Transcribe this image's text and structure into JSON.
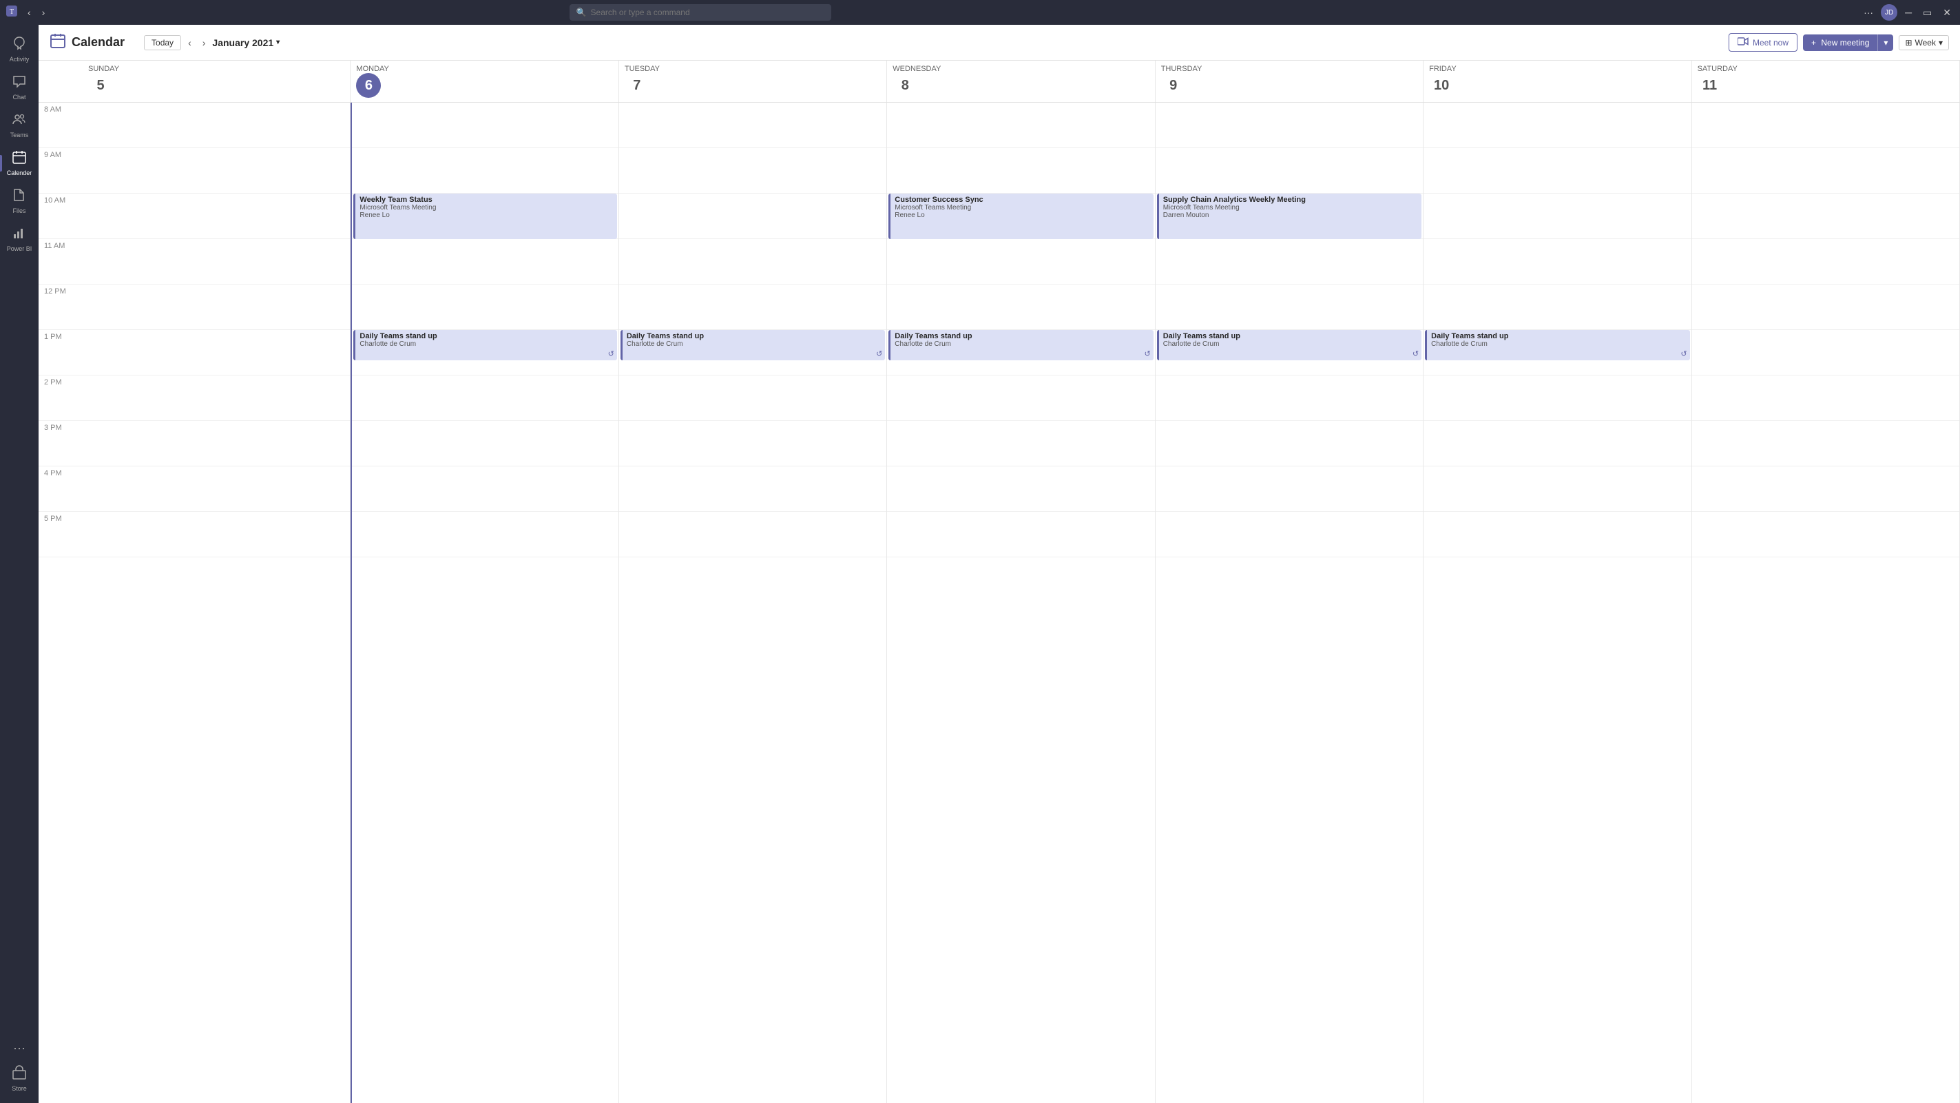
{
  "titlebar": {
    "logo": "⊞",
    "nav_back": "‹",
    "nav_forward": "›",
    "search_placeholder": "Search or type a command",
    "more": "···",
    "avatar_initials": "JD",
    "minimize": "─",
    "restore": "▭",
    "close": "✕"
  },
  "sidebar": {
    "items": [
      {
        "id": "activity",
        "label": "Activity",
        "icon": "🔔"
      },
      {
        "id": "chat",
        "label": "Chat",
        "icon": "💬"
      },
      {
        "id": "teams",
        "label": "Teams",
        "icon": "👥"
      },
      {
        "id": "calendar",
        "label": "Calender",
        "icon": "📅",
        "active": true
      },
      {
        "id": "files",
        "label": "Files",
        "icon": "📁"
      },
      {
        "id": "powerbi",
        "label": "Power BI",
        "icon": "📊"
      }
    ],
    "bottom_items": [
      {
        "id": "more",
        "label": "···",
        "icon": "···"
      },
      {
        "id": "store",
        "label": "Store",
        "icon": "🏪"
      }
    ]
  },
  "calendar": {
    "title": "Calendar",
    "today_label": "Today",
    "month_label": "January 2021",
    "meet_now_label": "Meet now",
    "new_meeting_label": "New meeting",
    "view_label": "Week",
    "days": [
      {
        "num": "5",
        "name": "Sunday",
        "today": false
      },
      {
        "num": "6",
        "name": "Monday",
        "today": true
      },
      {
        "num": "7",
        "name": "Tuesday",
        "today": false
      },
      {
        "num": "8",
        "name": "Wednesday",
        "today": false
      },
      {
        "num": "9",
        "name": "Thursday",
        "today": false
      },
      {
        "num": "10",
        "name": "Friday",
        "today": false
      },
      {
        "num": "11",
        "name": "Saturday",
        "today": false
      }
    ],
    "time_slots": [
      "8 AM",
      "9 AM",
      "10 AM",
      "11 AM",
      "12 PM",
      "1 PM",
      "2 PM",
      "3 PM",
      "4 PM",
      "5 PM"
    ],
    "events": [
      {
        "id": "ev1",
        "title": "Weekly Team Status",
        "sub1": "Microsoft Teams Meeting",
        "sub2": "Renee Lo",
        "day": 1,
        "slot_start": 2,
        "slot_offset": 0,
        "height": 66,
        "recurring": false
      },
      {
        "id": "ev2",
        "title": "Customer Success Sync",
        "sub1": "Microsoft Teams Meeting",
        "sub2": "Renee Lo",
        "day": 3,
        "slot_start": 2,
        "slot_offset": 0,
        "height": 66,
        "recurring": false
      },
      {
        "id": "ev3",
        "title": "Supply Chain Analytics Weekly Meeting",
        "sub1": "Microsoft Teams Meeting",
        "sub2": "Darren Mouton",
        "day": 4,
        "slot_start": 2,
        "slot_offset": 0,
        "height": 66,
        "recurring": false
      },
      {
        "id": "ev4",
        "title": "Daily Teams stand up",
        "sub1": "Charlotte de Crum",
        "day": 1,
        "slot_start": 5,
        "slot_offset": 0,
        "height": 44,
        "recurring": true
      },
      {
        "id": "ev5",
        "title": "Daily Teams stand up",
        "sub1": "Charlotte de Crum",
        "day": 2,
        "slot_start": 5,
        "slot_offset": 0,
        "height": 44,
        "recurring": true
      },
      {
        "id": "ev6",
        "title": "Daily Teams stand up",
        "sub1": "Charlotte de Crum",
        "day": 3,
        "slot_start": 5,
        "slot_offset": 0,
        "height": 44,
        "recurring": true
      },
      {
        "id": "ev7",
        "title": "Daily Teams stand up",
        "sub1": "Charlotte de Crum",
        "day": 4,
        "slot_start": 5,
        "slot_offset": 0,
        "height": 44,
        "recurring": true
      },
      {
        "id": "ev8",
        "title": "Daily Teams stand up",
        "sub1": "Charlotte de Crum",
        "day": 5,
        "slot_start": 5,
        "slot_offset": 0,
        "height": 44,
        "recurring": true
      }
    ]
  }
}
